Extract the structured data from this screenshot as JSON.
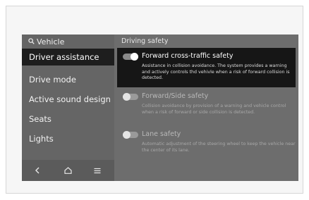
{
  "sidebar": {
    "header": {
      "label": "Vehicle",
      "icon": "search-icon"
    },
    "items": [
      {
        "label": "Driver assistance"
      },
      {
        "label": "Drive mode"
      },
      {
        "label": "Active sound design"
      },
      {
        "label": "Seats"
      },
      {
        "label": "Lights"
      }
    ],
    "nav": {
      "back_icon": "chevron-left-icon",
      "home_icon": "home-icon",
      "menu_icon": "menu-icon"
    }
  },
  "main": {
    "title": "Driving safety",
    "options": [
      {
        "title": "Forward cross-traffic safety",
        "description": "Assistance in collision avoidance. The system provides a warning and actively controls thd vehivle when a risk of forward collision is detected.",
        "enabled": true
      },
      {
        "title": "Forward/Side safety",
        "description": "Collision avoidance by provision of a warning and vehicle control when a risk of forward or side collision is detected.",
        "enabled": false
      },
      {
        "title": "Lane safety",
        "description": "Automatic adjustment of the steering wheel to keep the vehicle near the center of its lane.",
        "enabled": false
      }
    ]
  },
  "colors": {
    "screen_bg": "#6d6d6d",
    "sidebar_bg": "#656565",
    "active_bg": "#1e1e1e",
    "text_light": "#f2f2f2",
    "text_dim": "#b8b8b8"
  }
}
